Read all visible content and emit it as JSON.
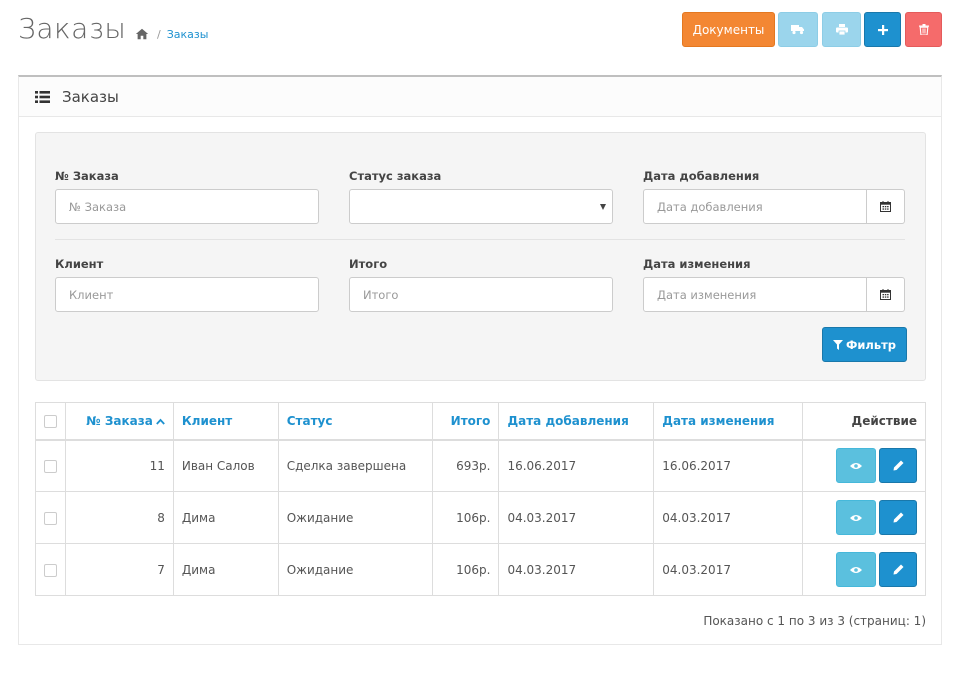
{
  "header": {
    "title": "Заказы",
    "breadcrumb_link": "Заказы",
    "btn_docs": "Документы"
  },
  "panel": {
    "title": "Заказы"
  },
  "filters": {
    "order_id_label": "№ Заказа",
    "order_id_placeholder": "№ Заказа",
    "status_label": "Статус заказа",
    "status_value": "",
    "date_added_label": "Дата добавления",
    "date_added_placeholder": "Дата добавления",
    "customer_label": "Клиент",
    "customer_placeholder": "Клиент",
    "total_label": "Итого",
    "total_placeholder": "Итого",
    "date_modified_label": "Дата изменения",
    "date_modified_placeholder": "Дата изменения",
    "filter_button": "Фильтр"
  },
  "table": {
    "columns": {
      "order_id": "№ Заказа",
      "customer": "Клиент",
      "status": "Статус",
      "total": "Итого",
      "date_added": "Дата добавления",
      "date_modified": "Дата изменения",
      "action": "Действие"
    },
    "rows": [
      {
        "order_id": "11",
        "customer": "Иван Салов",
        "status": "Сделка завершена",
        "total": "693р.",
        "date_added": "16.06.2017",
        "date_modified": "16.06.2017"
      },
      {
        "order_id": "8",
        "customer": "Дима",
        "status": "Ожидание",
        "total": "106р.",
        "date_added": "04.03.2017",
        "date_modified": "04.03.2017"
      },
      {
        "order_id": "7",
        "customer": "Дима",
        "status": "Ожидание",
        "total": "106р.",
        "date_added": "04.03.2017",
        "date_modified": "04.03.2017"
      }
    ]
  },
  "pagination": {
    "summary": "Показано с 1 по 3 из 3 (страниц: 1)"
  },
  "colors": {
    "primary": "#1e91cf",
    "info": "#5bc0de",
    "warning": "#f38733",
    "danger": "#f56b6b"
  }
}
